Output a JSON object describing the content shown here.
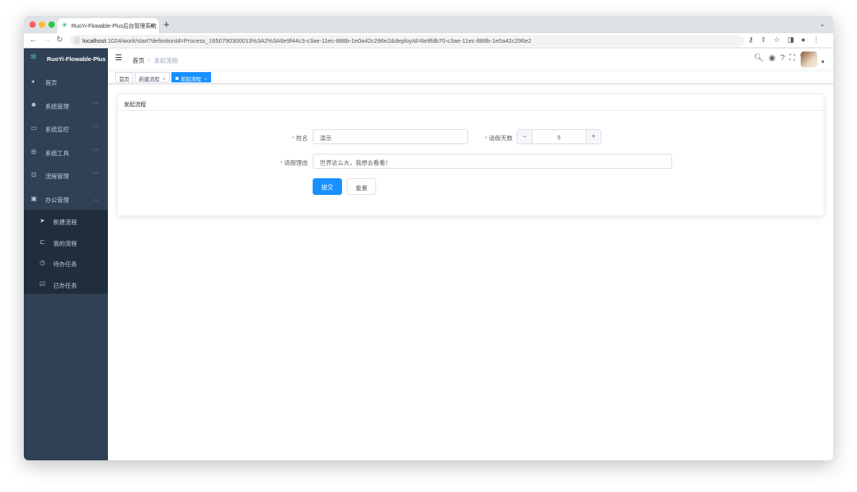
{
  "browser": {
    "tab_title": "RuoYi-Flowable-Plus后台管理系统",
    "url_host": "localhost",
    "url_rest": ":1024/work/start?definitionId=Process_1650790300013%3A2%3A6e9f44c3-c3ae-11ec-888b-1e0a42c296e2&deployId=6e8fdb70-c3ae-11ec-888b-1e0a42c296e2"
  },
  "sidebar": {
    "logo": "RuoYi-Flowable-Plus",
    "items": [
      {
        "label": "首页",
        "icon": "dashboard-icon",
        "glyph": "◕"
      },
      {
        "label": "系统管理",
        "icon": "gear-icon",
        "glyph": "✹",
        "arrow": "﹀"
      },
      {
        "label": "系统监控",
        "icon": "monitor-icon",
        "glyph": "▭",
        "arrow": "﹀"
      },
      {
        "label": "系统工具",
        "icon": "toolbox-icon",
        "glyph": "⊟",
        "arrow": "﹀"
      },
      {
        "label": "流程管理",
        "icon": "process-icon",
        "glyph": "⊡",
        "arrow": "﹀"
      },
      {
        "label": "办公管理",
        "icon": "office-icon",
        "glyph": "▣",
        "arrow": "︿"
      }
    ],
    "sub_items": [
      {
        "label": "新建流程",
        "icon": "paper-plane-icon",
        "glyph": "➤"
      },
      {
        "label": "我的流程",
        "icon": "tree-icon",
        "glyph": "⊏"
      },
      {
        "label": "待办任务",
        "icon": "clock-icon",
        "glyph": "◷"
      },
      {
        "label": "已办任务",
        "icon": "checkbox-icon",
        "glyph": "☑"
      }
    ]
  },
  "navbar": {
    "breadcrumb": [
      "首页",
      "发起流程"
    ]
  },
  "tags": [
    {
      "label": "首页"
    },
    {
      "label": "新建流程"
    },
    {
      "label": "发起流程",
      "active": true
    }
  ],
  "card": {
    "title": "发起流程",
    "form": {
      "name_label": "姓名",
      "name_value": "演示",
      "days_label": "请假天数",
      "days_value": "5",
      "reason_label": "请假理由",
      "reason_value": "世界这么大，我想去看看！",
      "required_mark": "*"
    },
    "submit": "提交",
    "reset": "重置"
  },
  "colors": {
    "sidebar": "#304156",
    "submenu": "#1f2d3d",
    "primary": "#1890ff"
  }
}
